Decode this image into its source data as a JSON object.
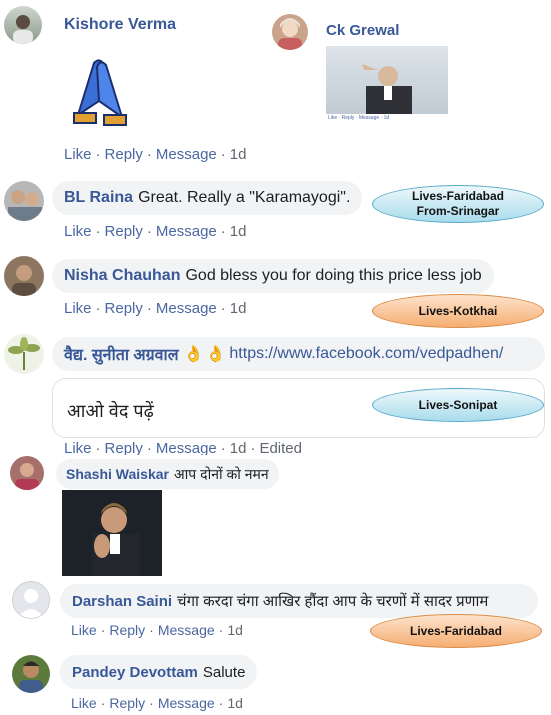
{
  "comments": [
    {
      "name": "Kishore Verma",
      "text": "",
      "time": "1d"
    },
    {
      "name": "BL Raina",
      "text": "Great. Really a \"Karamayogi\".",
      "time": "1d"
    },
    {
      "name": "Nisha Chauhan",
      "text": "God bless you for doing this price less job",
      "time": "1d"
    },
    {
      "name": "वैद्य. सुनीता अग्रवाल",
      "link": "https://www.facebook.com/vedpadhen/",
      "text": "आओ वेद पढ़ें",
      "time": "1d",
      "edited": "Edited"
    },
    {
      "name": "Shashi Waiskar",
      "text": "आप दोनों को नमन"
    },
    {
      "name": "Darshan Saini",
      "text": "चंगा करदा चंगा आखिर हौंदा आप के चरणों में सादर प्रणाम",
      "time": "1d"
    },
    {
      "name": "Pandey Devottam",
      "text": "Salute",
      "time": "1d"
    }
  ],
  "embedded": {
    "name": "Ck Grewal",
    "caption": "Like · Reply · Message · 1d"
  },
  "actions": {
    "like": "Like",
    "reply": "Reply",
    "message": "Message",
    "dot": "·"
  },
  "tags": {
    "faridabad_srinagar_1": "Lives-Faridabad",
    "faridabad_srinagar_2": "From-Srinagar",
    "kotkhai": "Lives-Kotkhai",
    "sonipat": "Lives-Sonipat",
    "faridabad": "Lives-Faridabad"
  },
  "emoji": {
    "ok_hand": "👌"
  },
  "colors": {
    "name": "#385898",
    "action": "#4b67a1",
    "bubble": "#f2f3f5",
    "tag_blue": "#a9dcec",
    "tag_orange": "#f6ae72"
  }
}
